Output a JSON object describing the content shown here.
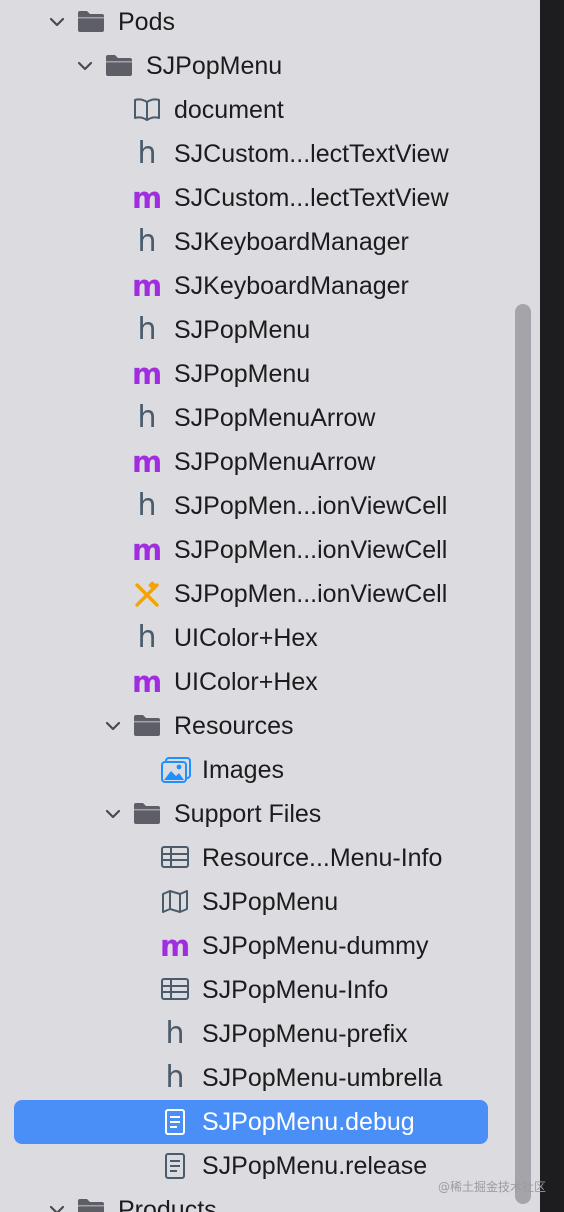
{
  "colors": {
    "background": "#dcdbe0",
    "selection": "#4a8ef7",
    "folder": "#5e5e66",
    "header_icon": "#4a5c6c",
    "implementation_icon": "#a02ee0",
    "xib_icon": "#f5a300",
    "assets_icon": "#1e90ff"
  },
  "watermark": "@稀土掘金技术社区",
  "tree": [
    {
      "label": "Pods",
      "icon": "folder-icon",
      "expanded": true
    },
    {
      "label": "SJPopMenu",
      "icon": "folder-icon",
      "expanded": true
    },
    {
      "label": "document",
      "icon": "book-icon"
    },
    {
      "label": "SJCustom...lectTextView",
      "icon": "header-file-icon"
    },
    {
      "label": "SJCustom...lectTextView",
      "icon": "implementation-file-icon"
    },
    {
      "label": "SJKeyboardManager",
      "icon": "header-file-icon"
    },
    {
      "label": "SJKeyboardManager",
      "icon": "implementation-file-icon"
    },
    {
      "label": "SJPopMenu",
      "icon": "header-file-icon"
    },
    {
      "label": "SJPopMenu",
      "icon": "implementation-file-icon"
    },
    {
      "label": "SJPopMenuArrow",
      "icon": "header-file-icon"
    },
    {
      "label": "SJPopMenuArrow",
      "icon": "implementation-file-icon"
    },
    {
      "label": "SJPopMen...ionViewCell",
      "icon": "header-file-icon"
    },
    {
      "label": "SJPopMen...ionViewCell",
      "icon": "implementation-file-icon"
    },
    {
      "label": "SJPopMen...ionViewCell",
      "icon": "xib-file-icon"
    },
    {
      "label": "UIColor+Hex",
      "icon": "header-file-icon"
    },
    {
      "label": "UIColor+Hex",
      "icon": "implementation-file-icon"
    },
    {
      "label": "Resources",
      "icon": "folder-icon",
      "expanded": true
    },
    {
      "label": "Images",
      "icon": "asset-catalog-icon"
    },
    {
      "label": "Support Files",
      "icon": "folder-icon",
      "expanded": true
    },
    {
      "label": "Resource...Menu-Info",
      "icon": "plist-table-icon"
    },
    {
      "label": "SJPopMenu",
      "icon": "modulemap-icon"
    },
    {
      "label": "SJPopMenu-dummy",
      "icon": "implementation-file-icon"
    },
    {
      "label": "SJPopMenu-Info",
      "icon": "plist-table-icon"
    },
    {
      "label": "SJPopMenu-prefix",
      "icon": "header-file-icon"
    },
    {
      "label": "SJPopMenu-umbrella",
      "icon": "header-file-icon"
    },
    {
      "label": "SJPopMenu.debug",
      "icon": "document-icon",
      "selected": true
    },
    {
      "label": "SJPopMenu.release",
      "icon": "document-icon"
    },
    {
      "label": "Products",
      "icon": "folder-icon",
      "expanded": true
    }
  ]
}
